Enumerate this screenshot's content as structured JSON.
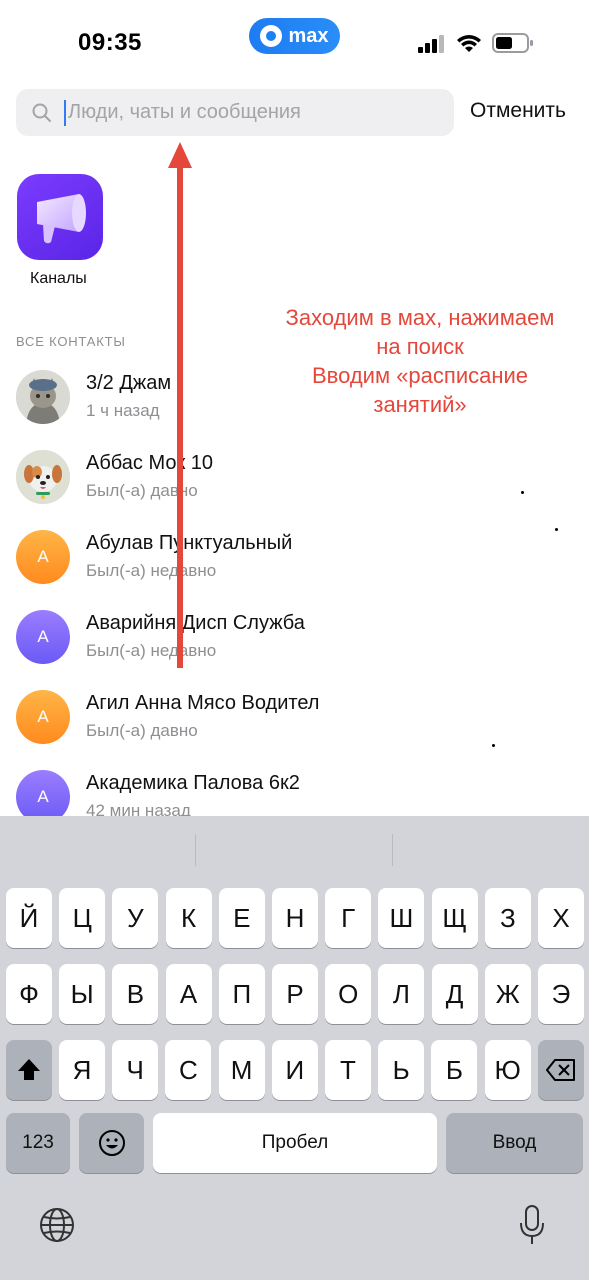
{
  "status_bar": {
    "time": "09:35",
    "app_pill": "max",
    "icons": [
      "signal-icon",
      "wifi-icon",
      "battery-icon"
    ]
  },
  "search": {
    "placeholder": "Люди, чаты и сообщения",
    "value": "",
    "cancel_label": "Отменить"
  },
  "channels": {
    "label": "Каналы",
    "icon": "megaphone-icon"
  },
  "contacts_section": {
    "title": "ВСЕ КОНТАКТЫ",
    "items": [
      {
        "name": "3/2 Джам",
        "status": "1 ч назад",
        "avatar": "photo-cat"
      },
      {
        "name": "Аббас Мок 10",
        "status": "Был(-а) давно",
        "avatar": "photo-dog"
      },
      {
        "name": "Абулав Пунктуальный",
        "status": "Был(-а) недавно",
        "avatar": "А"
      },
      {
        "name": "Аварийня Дисп Служба",
        "status": "Был(-а) недавно",
        "avatar": "А"
      },
      {
        "name": "Агил Анна Мясо Водител",
        "status": "Был(-а) давно",
        "avatar": "А"
      },
      {
        "name": "Академика Палова 6к2",
        "status": "42 мин назад",
        "avatar": "А"
      }
    ]
  },
  "annotation": {
    "lines": [
      "Заходим в мах, нажимаем",
      "на поиск",
      "Вводим «расписание",
      "занятий»"
    ],
    "color": "#e5473b"
  },
  "keyboard": {
    "row1": [
      "Й",
      "Ц",
      "У",
      "К",
      "Е",
      "Н",
      "Г",
      "Ш",
      "Щ",
      "З",
      "Х"
    ],
    "row2": [
      "Ф",
      "Ы",
      "В",
      "А",
      "П",
      "Р",
      "О",
      "Л",
      "Д",
      "Ж",
      "Э"
    ],
    "row3": [
      "Я",
      "Ч",
      "С",
      "М",
      "И",
      "Т",
      "Ь",
      "Б",
      "Ю"
    ],
    "numbers_label": "123",
    "space_label": "Пробел",
    "return_label": "Ввод",
    "icons": [
      "shift-icon",
      "backspace-icon",
      "emoji-icon",
      "globe-icon",
      "microphone-icon"
    ]
  },
  "colors": {
    "accent": "#1d7cf2",
    "channel_tile": "#6a2ff0",
    "avatar_orange": "#ff9d2e",
    "avatar_violet": "#7c6af8"
  }
}
